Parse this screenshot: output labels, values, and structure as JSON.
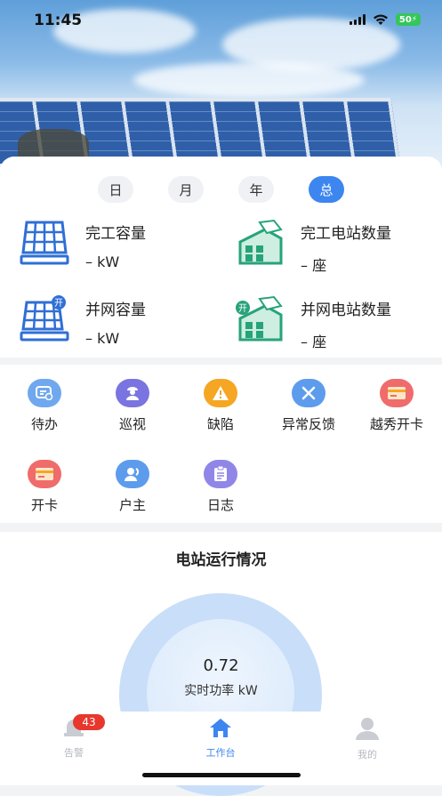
{
  "status_bar": {
    "time": "11:45",
    "battery": "50"
  },
  "period_tabs": [
    "日",
    "月",
    "年",
    "总"
  ],
  "active_period": "总",
  "stats": [
    {
      "label": "完工容量",
      "value": "– kW",
      "icon": "solar-panel-icon"
    },
    {
      "label": "完工电站数量",
      "value": "– 座",
      "icon": "station-building-icon"
    },
    {
      "label": "并网容量",
      "value": "– kW",
      "icon": "grid-solar-panel-icon"
    },
    {
      "label": "并网电站数量",
      "value": "– 座",
      "icon": "grid-station-building-icon"
    }
  ],
  "functions": [
    {
      "label": "待办",
      "icon": "todo-icon",
      "color": "#6fa8ee"
    },
    {
      "label": "巡视",
      "icon": "inspect-icon",
      "color": "#7a74e0"
    },
    {
      "label": "缺陷",
      "icon": "warning-icon",
      "color": "#f5a623"
    },
    {
      "label": "异常反馈",
      "icon": "tools-icon",
      "color": "#5d9cec"
    },
    {
      "label": "越秀开卡",
      "icon": "card-icon",
      "color": "#f06b6b"
    },
    {
      "label": "开卡",
      "icon": "card-icon",
      "color": "#f06b6b"
    },
    {
      "label": "户主",
      "icon": "user-icon",
      "color": "#5d9cec"
    },
    {
      "label": "日志",
      "icon": "log-icon",
      "color": "#8f86e8"
    }
  ],
  "station_section": {
    "title": "电站运行情况",
    "power_value": "0.72",
    "power_label": "实时功率 kW"
  },
  "tabbar": {
    "items": [
      {
        "label": "告警",
        "icon": "alarm-bell-icon"
      },
      {
        "label": "工作台",
        "icon": "home-icon"
      },
      {
        "label": "我的",
        "icon": "profile-icon"
      }
    ],
    "active": "工作台",
    "alarm_badge": "43"
  }
}
